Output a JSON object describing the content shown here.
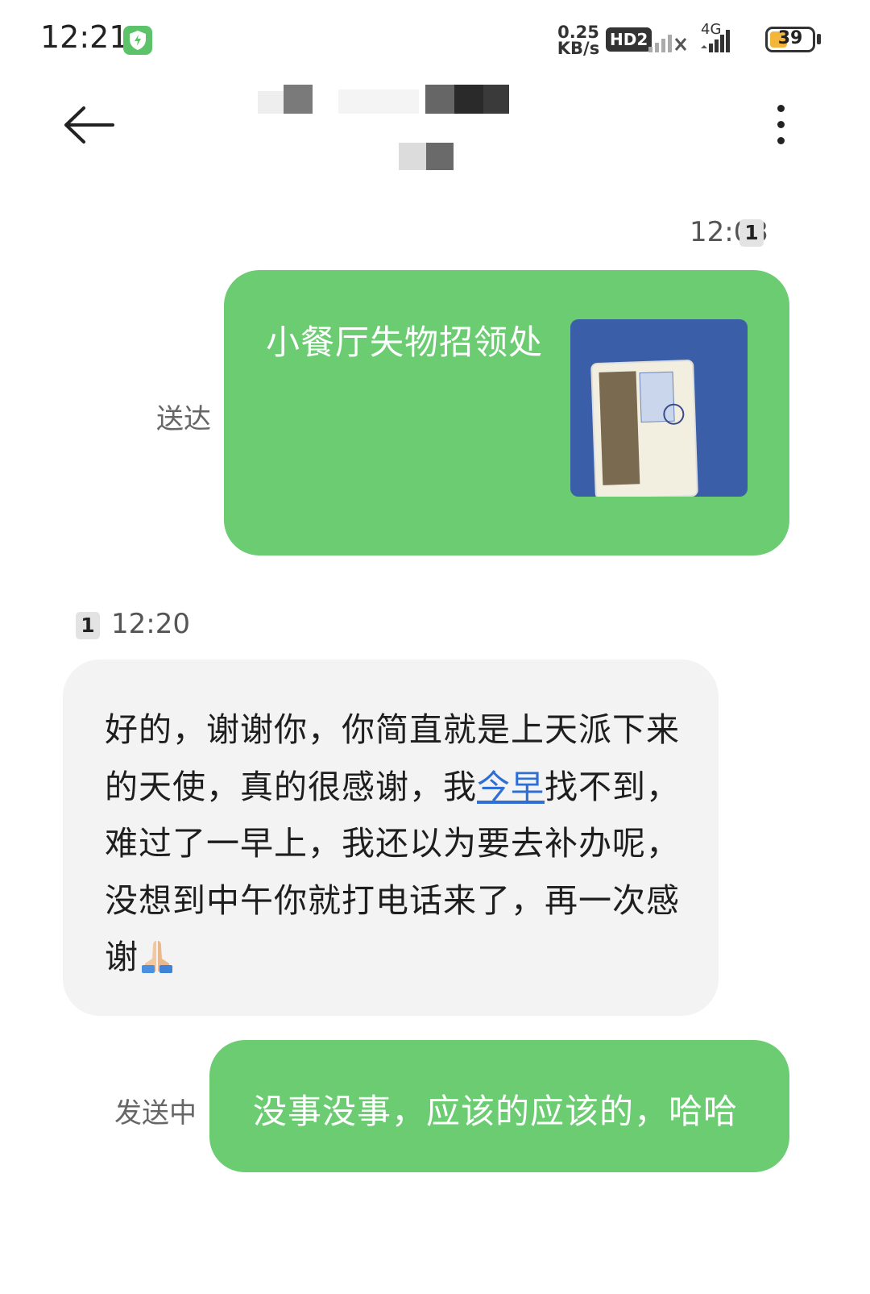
{
  "status_bar": {
    "time": "12:21",
    "net_speed_value": "0.25",
    "net_speed_unit": "KB/s",
    "hd_label": "HD2",
    "network_label": "4G",
    "battery_percent": "39"
  },
  "header": {
    "contact_name": ""
  },
  "messages": {
    "first_time": "12:03",
    "first_sim": "1",
    "first_status": "送达",
    "first_text": "小餐厅失物招领处",
    "second_time": "12:20",
    "second_sim": "1",
    "second_text_part1": "好的，谢谢你，你简直就是上天派下来的天使，真的很感谢，我",
    "second_text_link": "今早",
    "second_text_part2": "找不到，难过了一早上，我还以为要去补办呢，没想到中午你就打电话来了，再一次感谢",
    "third_status": "发送中",
    "third_text": "没事没事，应该的应该的，哈哈"
  },
  "colors": {
    "outgoing_bubble": "#6bcc72",
    "incoming_bubble": "#f3f3f3",
    "link": "#2f6fd3"
  }
}
